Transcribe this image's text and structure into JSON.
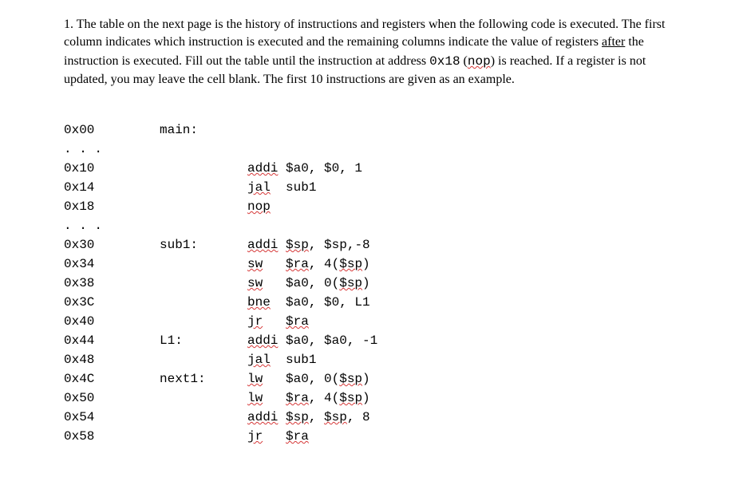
{
  "question": {
    "num": "1.",
    "text_1": " The table on the next page is the history of instructions and registers when the following code is executed. The first column indicates which instruction is executed and the remaining columns indicate the value of registers ",
    "text_after": "after",
    "text_2": " the instruction is executed. Fill out the table until the instruction at address ",
    "text_addr": "0x18",
    "text_3": " (",
    "text_nop": "nop",
    "text_4": ") is reached. If a register is not updated, you may leave the cell blank. The first 10 instructions are given as an example."
  },
  "code": [
    {
      "addr": "0x00",
      "label": "main:",
      "instr": ""
    },
    {
      "addr": ". . .",
      "label": "",
      "instr": ""
    },
    {
      "addr": "0x10",
      "label": "",
      "parts": [
        {
          "t": "addi",
          "s": true
        },
        {
          "t": " $a0, $0, 1"
        }
      ]
    },
    {
      "addr": "0x14",
      "label": "",
      "parts": [
        {
          "t": "jal",
          "s": true
        },
        {
          "t": "  sub1"
        }
      ]
    },
    {
      "addr": "0x18",
      "label": "",
      "parts": [
        {
          "t": "nop",
          "s": true
        }
      ]
    },
    {
      "addr": ". . .",
      "label": "",
      "instr": ""
    },
    {
      "addr": "0x30",
      "label": "sub1:",
      "parts": [
        {
          "t": "addi",
          "s": true
        },
        {
          "t": " "
        },
        {
          "t": "$sp",
          "s": true
        },
        {
          "t": ", $sp,-8"
        }
      ]
    },
    {
      "addr": "0x34",
      "label": "",
      "parts": [
        {
          "t": "sw",
          "s": true
        },
        {
          "t": "   "
        },
        {
          "t": "$ra",
          "s": true
        },
        {
          "t": ", 4("
        },
        {
          "t": "$sp",
          "s": true
        },
        {
          "t": ")"
        }
      ]
    },
    {
      "addr": "0x38",
      "label": "",
      "parts": [
        {
          "t": "sw",
          "s": true
        },
        {
          "t": "   $a0, 0("
        },
        {
          "t": "$sp",
          "s": true
        },
        {
          "t": ")"
        }
      ]
    },
    {
      "addr": "0x3C",
      "label": "",
      "parts": [
        {
          "t": "bne",
          "s": true
        },
        {
          "t": "  $a0, $0, L1"
        }
      ]
    },
    {
      "addr": "0x40",
      "label": "",
      "parts": [
        {
          "t": "jr",
          "s": true
        },
        {
          "t": "   "
        },
        {
          "t": "$ra",
          "s": true
        }
      ]
    },
    {
      "addr": "0x44",
      "label": "L1:",
      "parts": [
        {
          "t": "addi",
          "s": true
        },
        {
          "t": " $a0, $a0, -1"
        }
      ]
    },
    {
      "addr": "0x48",
      "label": "",
      "parts": [
        {
          "t": "jal",
          "s": true
        },
        {
          "t": "  sub1"
        }
      ]
    },
    {
      "addr": "0x4C",
      "label": "next1:",
      "parts": [
        {
          "t": "lw",
          "s": true
        },
        {
          "t": "   $a0, 0("
        },
        {
          "t": "$sp",
          "s": true
        },
        {
          "t": ")"
        }
      ]
    },
    {
      "addr": "0x50",
      "label": "",
      "parts": [
        {
          "t": "lw",
          "s": true
        },
        {
          "t": "   "
        },
        {
          "t": "$ra",
          "s": true
        },
        {
          "t": ", 4("
        },
        {
          "t": "$sp",
          "s": true
        },
        {
          "t": ")"
        }
      ]
    },
    {
      "addr": "0x54",
      "label": "",
      "parts": [
        {
          "t": "addi",
          "s": true
        },
        {
          "t": " "
        },
        {
          "t": "$sp",
          "s": true
        },
        {
          "t": ", "
        },
        {
          "t": "$sp",
          "s": true
        },
        {
          "t": ", 8"
        }
      ]
    },
    {
      "addr": "0x58",
      "label": "",
      "parts": [
        {
          "t": "jr",
          "s": true
        },
        {
          "t": "   "
        },
        {
          "t": "$ra",
          "s": true
        }
      ]
    }
  ]
}
